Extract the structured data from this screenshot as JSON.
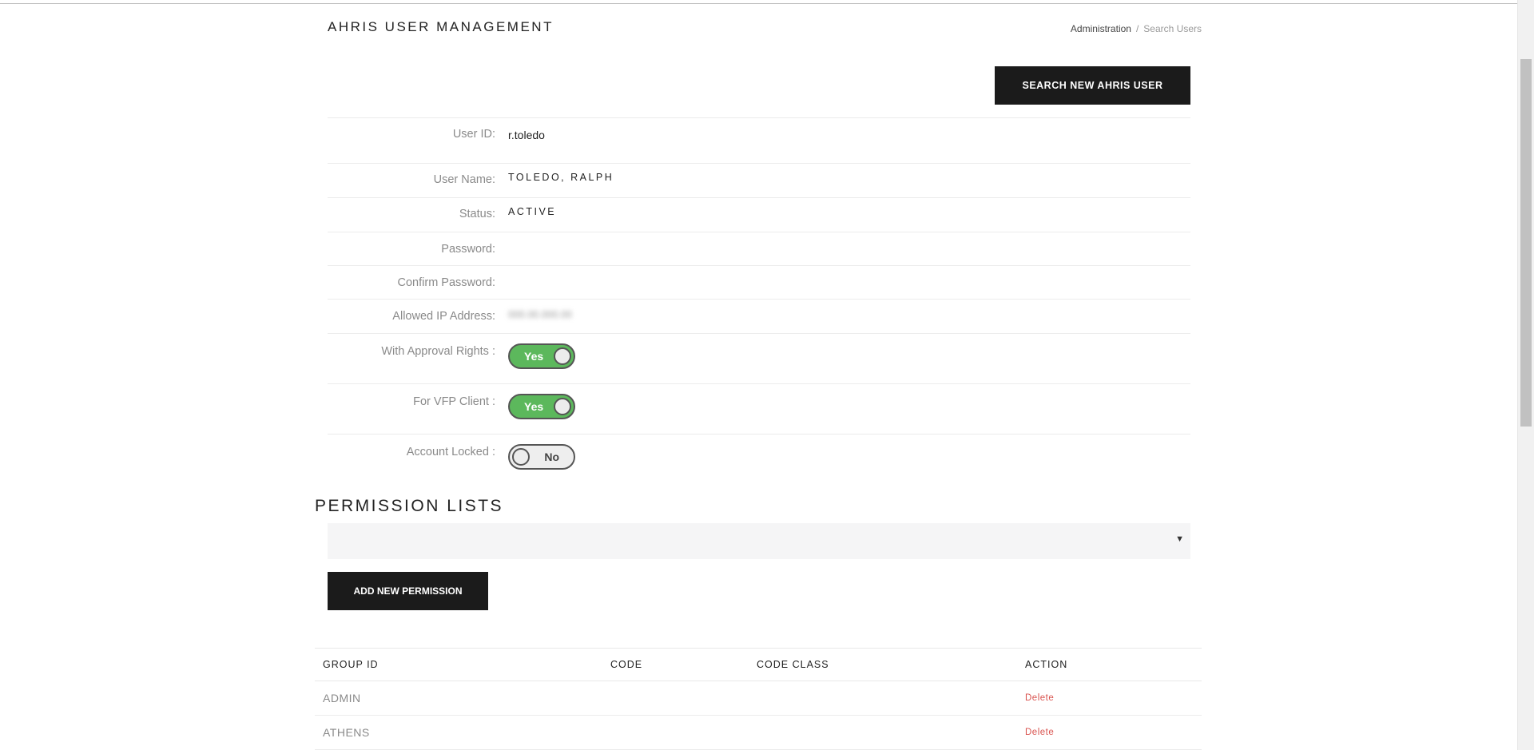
{
  "header": {
    "title": "AHRIS USER MANAGEMENT",
    "breadcrumb": {
      "parent": "Administration",
      "separator": "/",
      "current": "Search Users"
    }
  },
  "actions": {
    "search_new_user": "SEARCH NEW AHRIS USER",
    "add_permission": "ADD NEW PERMISSION"
  },
  "form": {
    "user_id": {
      "label": "User ID:",
      "value": "r.toledo"
    },
    "user_name": {
      "label": "User Name:",
      "value": "TOLEDO, RALPH"
    },
    "status": {
      "label": "Status:",
      "value": "ACTIVE"
    },
    "password": {
      "label": "Password:",
      "value": ""
    },
    "confirm_password": {
      "label": "Confirm Password:",
      "value": ""
    },
    "allowed_ip": {
      "label": "Allowed IP Address:",
      "value": "000.00.000.00"
    },
    "approval_rights": {
      "label": "With Approval Rights :",
      "state": "Yes",
      "on": true
    },
    "vfp_client": {
      "label": "For VFP Client :",
      "state": "Yes",
      "on": true
    },
    "account_locked": {
      "label": "Account Locked :",
      "state": "No",
      "on": false
    }
  },
  "permissions": {
    "title": "PERMISSION LISTS",
    "select_value": "",
    "select_arrow": "▼",
    "columns": [
      "GROUP ID",
      "CODE",
      "CODE CLASS",
      "ACTION"
    ],
    "rows": [
      {
        "group_id": "ADMIN",
        "code": "",
        "code_class": "",
        "action": "Delete"
      },
      {
        "group_id": "ATHENS",
        "code": "",
        "code_class": "",
        "action": "Delete"
      }
    ]
  },
  "colors": {
    "toggle_on": "#5cb85c",
    "delete_link": "#d9534f",
    "button_dark": "#1b1b1b"
  }
}
